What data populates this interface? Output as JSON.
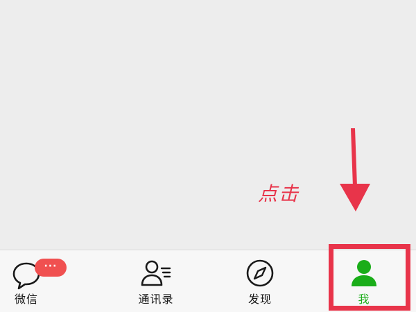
{
  "tabbar": {
    "tabs": [
      {
        "label": "微信",
        "icon": "chat-bubble-icon",
        "active": false
      },
      {
        "label": "通讯录",
        "icon": "contacts-icon",
        "active": false
      },
      {
        "label": "发现",
        "icon": "compass-icon",
        "active": false
      },
      {
        "label": "我",
        "icon": "person-icon",
        "active": true
      }
    ],
    "badge": "···"
  },
  "annotation": {
    "text": "点击",
    "color": "#e8344a"
  },
  "colors": {
    "active": "#1aad19",
    "badge": "#f05050",
    "background": "#ededed",
    "tabbar": "#f7f7f7"
  }
}
